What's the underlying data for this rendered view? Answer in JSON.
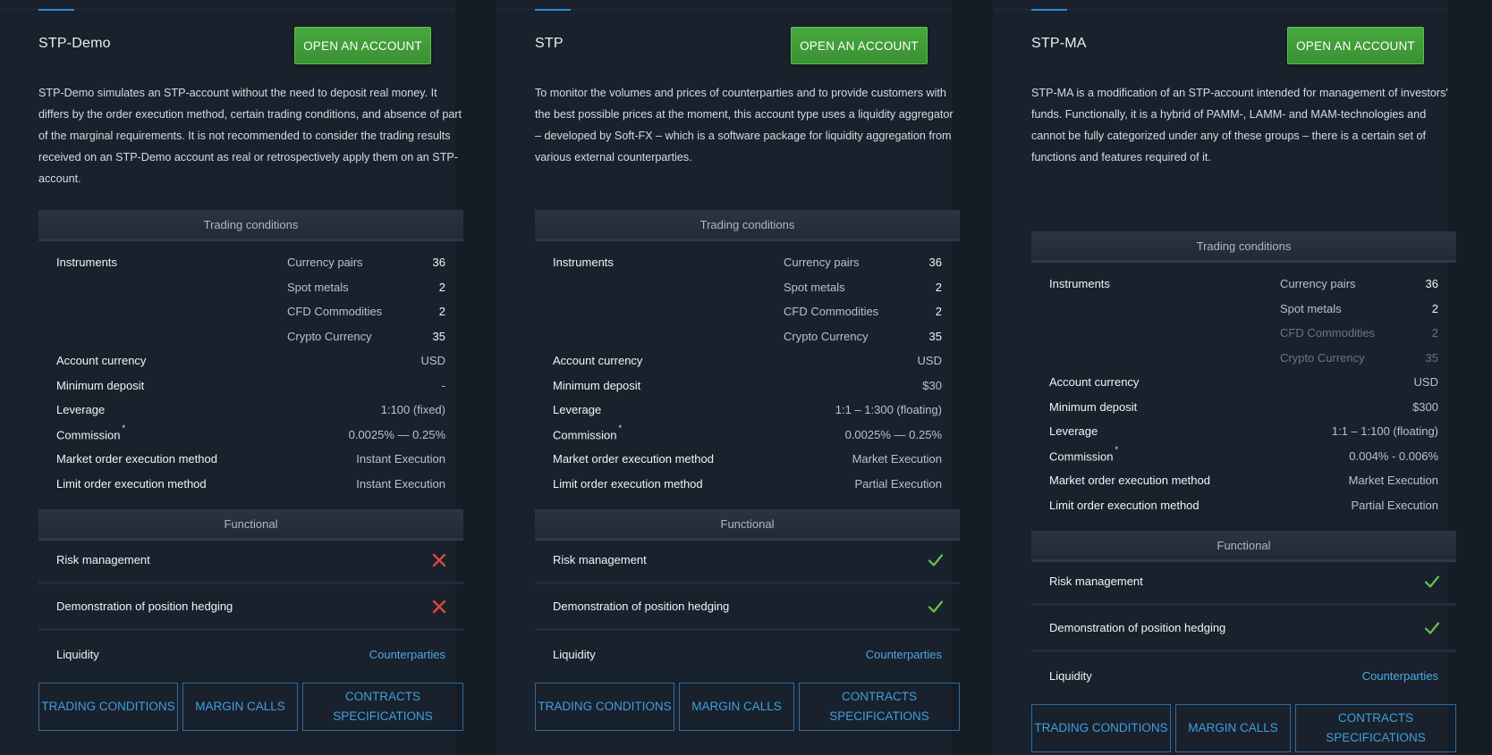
{
  "cards": [
    {
      "title": "STP-Demo",
      "open_label": "OPEN AN ACCOUNT",
      "description": "STP-Demo simulates an STP-account without the need to deposit real money. It differs by the order execution method, certain trading conditions, and absence of part of the marginal requirements. It is not recommended to consider the trading results received on an STP-Demo account as real or retrospectively apply them on an STP-account.",
      "trading_conditions_label": "Trading conditions",
      "instruments_label": "Instruments",
      "instruments": [
        {
          "name": "Currency pairs",
          "count": "36"
        },
        {
          "name": "Spot metals",
          "count": "2"
        },
        {
          "name": "CFD Commodities",
          "count": "2"
        },
        {
          "name": "Crypto Currency",
          "count": "35"
        }
      ],
      "account_currency_label": "Account currency",
      "account_currency": "USD",
      "min_deposit_label": "Minimum deposit",
      "min_deposit": "-",
      "leverage_label": "Leverage",
      "leverage": "1:100 (fixed)",
      "commission_label": "Commission",
      "commission": "0.0025% — 0.25%",
      "market_exec_label": "Market order execution method",
      "market_exec": "Instant Execution",
      "limit_exec_label": "Limit order execution method",
      "limit_exec": "Instant Execution",
      "functional_label": "Functional",
      "risk_label": "Risk management",
      "risk": "no",
      "hedging_label": "Demonstration of position hedging",
      "hedging": "no",
      "liquidity_label": "Liquidity",
      "liquidity": "Counterparties",
      "btn_trading": "TRADING CONDITIONS",
      "btn_margin": "MARGIN CALLS",
      "btn_contracts": "CONTRACTS SPECIFICATIONS"
    },
    {
      "title": "STP",
      "open_label": "OPEN AN ACCOUNT",
      "description": "To monitor the volumes and prices of counterparties and to provide customers with the best possible prices at the moment, this account type uses a liquidity aggregator – developed by Soft-FX – which is a software package for liquidity aggregation from various external counterparties.",
      "trading_conditions_label": "Trading conditions",
      "instruments_label": "Instruments",
      "instruments": [
        {
          "name": "Currency pairs",
          "count": "36"
        },
        {
          "name": "Spot metals",
          "count": "2"
        },
        {
          "name": "CFD Commodities",
          "count": "2"
        },
        {
          "name": "Crypto Currency",
          "count": "35"
        }
      ],
      "account_currency_label": "Account currency",
      "account_currency": "USD",
      "min_deposit_label": "Minimum deposit",
      "min_deposit": "$30",
      "leverage_label": "Leverage",
      "leverage": "1:1 – 1:300 (floating)",
      "commission_label": "Commission",
      "commission": "0.0025% — 0.25%",
      "market_exec_label": "Market order execution method",
      "market_exec": "Market Execution",
      "limit_exec_label": "Limit order execution method",
      "limit_exec": "Partial Execution",
      "functional_label": "Functional",
      "risk_label": "Risk management",
      "risk": "yes",
      "hedging_label": "Demonstration of position hedging",
      "hedging": "yes",
      "liquidity_label": "Liquidity",
      "liquidity": "Counterparties",
      "btn_trading": "TRADING CONDITIONS",
      "btn_margin": "MARGIN CALLS",
      "btn_contracts": "CONTRACTS SPECIFICATIONS"
    },
    {
      "title": "STP-MA",
      "open_label": "OPEN AN ACCOUNT",
      "description": "STP-MA is a modification of an STP-account intended for management of investors' funds. Functionally, it is a hybrid of PAMM-, LAMM- and MAM-technologies and cannot be fully categorized under any of these groups – there is a certain set of functions and features required of it.",
      "trading_conditions_label": "Trading conditions",
      "instruments_label": "Instruments",
      "instruments": [
        {
          "name": "Currency pairs",
          "count": "36"
        },
        {
          "name": "Spot metals",
          "count": "2"
        },
        {
          "name": "CFD Commodities",
          "count": "2"
        },
        {
          "name": "Crypto Currency",
          "count": "35"
        }
      ],
      "account_currency_label": "Account currency",
      "account_currency": "USD",
      "min_deposit_label": "Minimum deposit",
      "min_deposit": "$300",
      "leverage_label": "Leverage",
      "leverage": "1:1 – 1:100 (floating)",
      "commission_label": "Commission",
      "commission": "0.004% - 0.006%",
      "market_exec_label": "Market order execution method",
      "market_exec": "Market Execution",
      "limit_exec_label": "Limit order execution method",
      "limit_exec": "Partial Execution",
      "functional_label": "Functional",
      "risk_label": "Risk management",
      "risk": "yes",
      "hedging_label": "Demonstration of position hedging",
      "hedging": "yes",
      "liquidity_label": "Liquidity",
      "liquidity": "Counterparties",
      "btn_trading": "TRADING CONDITIONS",
      "btn_margin": "MARGIN CALLS",
      "btn_contracts": "CONTRACTS SPECIFICATIONS"
    }
  ],
  "colors": {
    "accent": "#2d8bd6",
    "green": "#3a9132",
    "check": "#6cc24a",
    "cross": "#e0463e",
    "link": "#4fa8e0"
  },
  "icons": {
    "yes": "check-icon",
    "no": "cross-icon"
  }
}
